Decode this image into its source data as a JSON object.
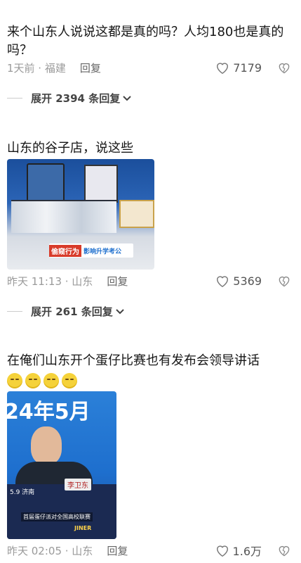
{
  "comments": [
    {
      "text": "来个山东人说说这都是真的吗？人均180也是真的吗？",
      "time": "1天前 · 福建",
      "reply": "回复",
      "likes": "7179",
      "expand": "展开 2394 条回复"
    },
    {
      "text": "山东的谷子店，说这些",
      "time": "昨天 11:13 · 山东",
      "reply": "回复",
      "likes": "5369",
      "expand": "展开 261 条回复",
      "image_texts": {
        "sign": "偷窥行为",
        "sign2": "影响升学考公"
      }
    },
    {
      "text": "在俺们山东开个蛋仔比赛也有发布会领导讲话",
      "emoji_count": 4,
      "time": "昨天 02:05 · 山东",
      "reply": "回复",
      "likes": "1.6万",
      "image_texts": {
        "banner": "24年5月",
        "nameplate": "李卫东",
        "tag": "5.9 济南",
        "caption": "首届蛋仔派对全国高校联赛",
        "logo": "JINER"
      }
    }
  ],
  "colors": {
    "text": "#161616",
    "meta": "#999999",
    "blue": "#1e6fce"
  }
}
